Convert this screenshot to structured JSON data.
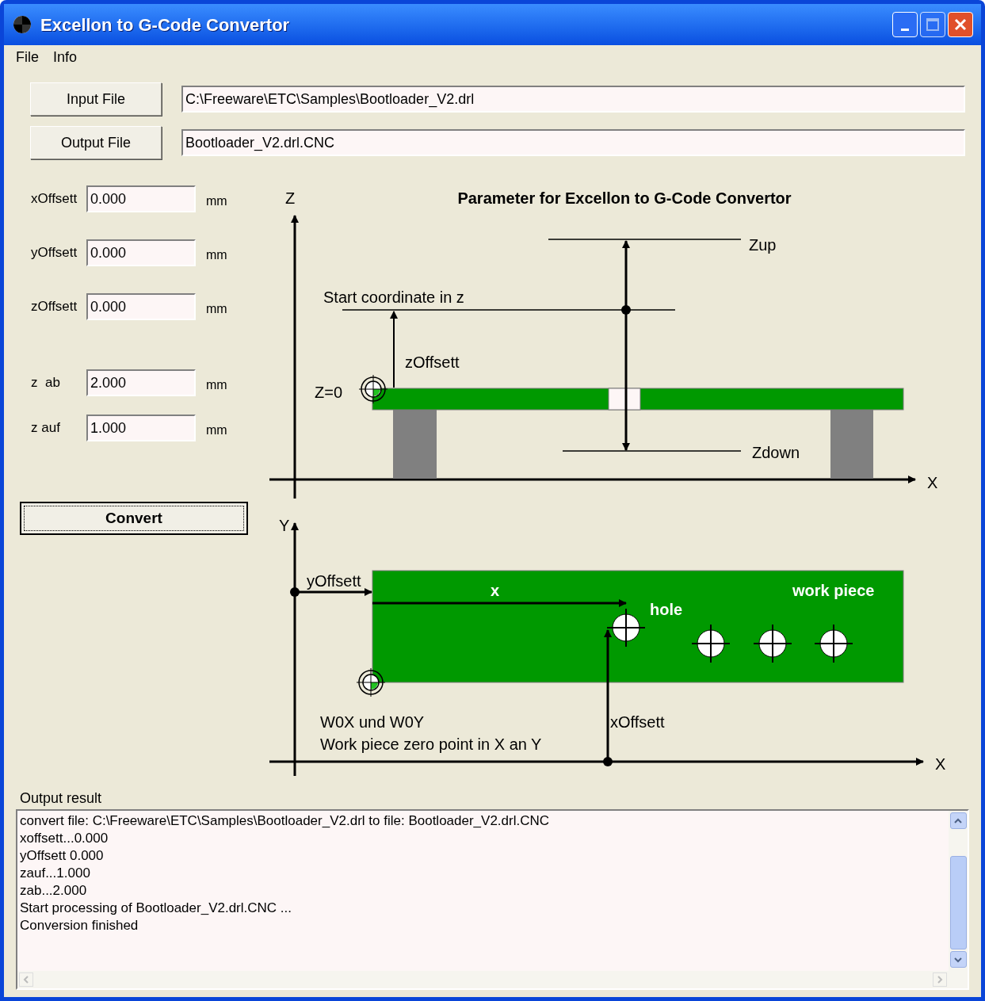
{
  "window": {
    "title": "Excellon to G-Code Convertor"
  },
  "menu": [
    "File",
    "Info"
  ],
  "files": [
    {
      "button": "Input File",
      "value": "C:\\Freeware\\ETC\\Samples\\Bootloader_V2.drl"
    },
    {
      "button": "Output File",
      "value": "Bootloader_V2.drl.CNC"
    }
  ],
  "parameters": [
    {
      "label": "xOffsett",
      "value": "0.000",
      "unit": "mm"
    },
    {
      "label": "yOffsett",
      "value": "0.000",
      "unit": "mm"
    },
    {
      "label": "zOffsett",
      "value": "0.000",
      "unit": "mm"
    },
    {
      "label": "z  ab",
      "value": "2.000",
      "unit": "mm"
    },
    {
      "label": "z auf",
      "value": "1.000",
      "unit": "mm"
    }
  ],
  "convert_button": "Convert",
  "diagram": {
    "title": "Parameter for Excellon to G-Code Convertor",
    "side_view": {
      "z_axis": "Z",
      "x_axis": "X",
      "z_up": "Zup",
      "start": "Start coordinate in z",
      "z_offset": "zOffsett",
      "z_zero": "Z=0",
      "z_down": "Zdown"
    },
    "top_view": {
      "y_axis": "Y",
      "x_axis": "X",
      "y_offset": "yOffsett",
      "x": "x",
      "hole": "hole",
      "work_piece": "work piece",
      "x_offset": "xOffsett",
      "zero_point": [
        "W0X und W0Y",
        "Work piece zero point in X an Y"
      ]
    }
  },
  "output": {
    "label": "Output result",
    "lines": [
      "convert file: C:\\Freeware\\ETC\\Samples\\Bootloader_V2.drl to file: Bootloader_V2.drl.CNC",
      "xoffsett...0.000",
      "yOffsett 0.000",
      "zauf...1.000",
      "zab...2.000",
      "Start processing of Bootloader_V2.drl.CNC ...",
      "Conversion finished"
    ]
  }
}
